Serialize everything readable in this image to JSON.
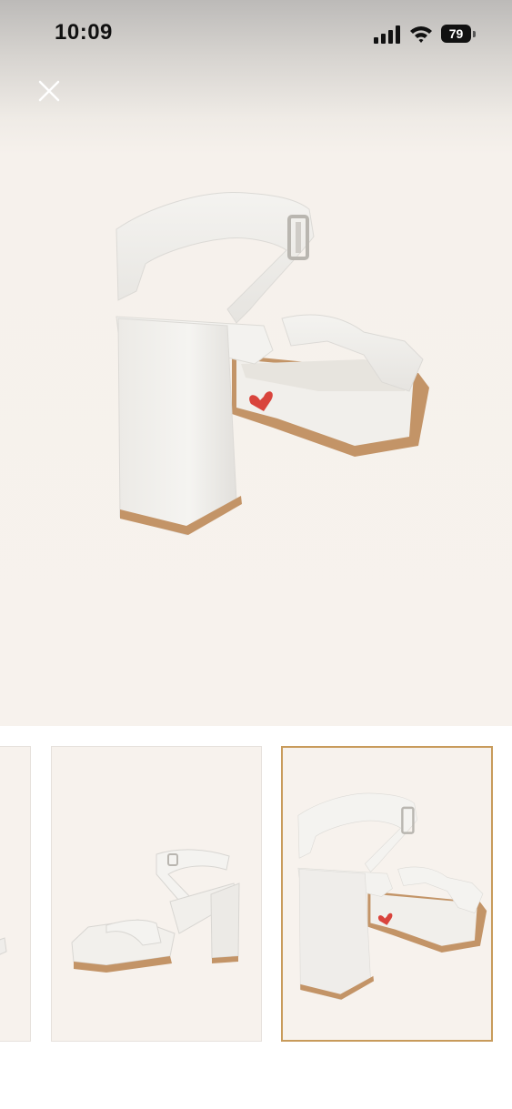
{
  "status_bar": {
    "time": "10:09",
    "battery_level": "79",
    "icons": [
      "signal-icon",
      "wifi-icon",
      "battery-icon"
    ]
  },
  "viewer": {
    "close_icon": "close-icon",
    "main_image": "white-platform-sandal-back-view"
  },
  "thumbnails": [
    {
      "image": "sandal-partial-view",
      "selected": false
    },
    {
      "image": "white-platform-sandal-side-view",
      "selected": false
    },
    {
      "image": "white-platform-sandal-back-view",
      "selected": true
    }
  ],
  "colors": {
    "background": "#f7f2ed",
    "selected_border": "#c89b5b",
    "sole": "#b8895a",
    "heart": "#d9443c"
  }
}
